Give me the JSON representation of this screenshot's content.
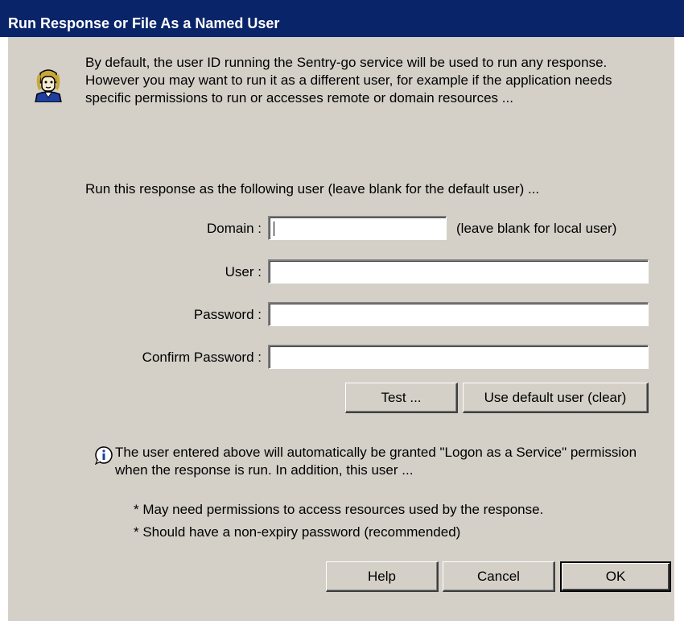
{
  "window": {
    "title": "Run Response or File As a Named User"
  },
  "intro_text": "By default, the user ID running the Sentry-go service will be used to run any response. However you may want to run it as a different user, for example if the application needs specific permissions to run or accesses remote or domain resources ...",
  "instruction": "Run this response as the following user (leave blank for the default user) ...",
  "form": {
    "domain": {
      "label": "Domain :",
      "value": "",
      "hint": "(leave blank for local user)"
    },
    "user": {
      "label": "User :",
      "value": ""
    },
    "password": {
      "label": "Password :",
      "value": ""
    },
    "confirm_password": {
      "label": "Confirm Password :",
      "value": ""
    }
  },
  "buttons": {
    "test": "Test ...",
    "use_default": "Use default user (clear)",
    "help": "Help",
    "cancel": "Cancel",
    "ok": "OK"
  },
  "note": "The user entered above will automatically be granted \"Logon as a Service\" permission when the response is run. In addition, this user ...",
  "bullets": [
    "* May need permissions to access resources used by the response.",
    "* Should have a non-expiry password (recommended)"
  ],
  "icons": {
    "intro": "user-icon",
    "note": "info-icon"
  },
  "colors": {
    "titlebar": "#0a246a",
    "dialog_face": "#d4d0c8"
  }
}
